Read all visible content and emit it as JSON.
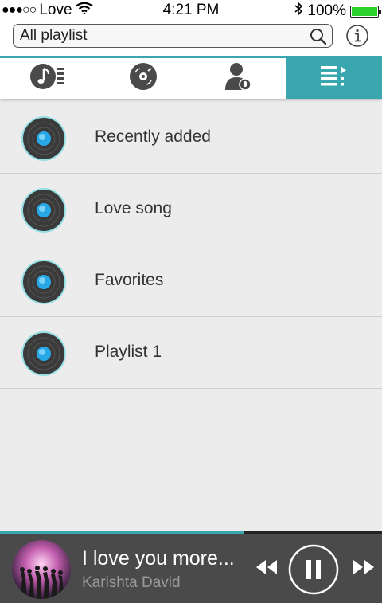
{
  "status_bar": {
    "signal": "●●●○○",
    "carrier": "Love",
    "time": "4:21 PM",
    "battery": "100%",
    "battery_level": 1.0
  },
  "search": {
    "value": "All playlist"
  },
  "tabs": [
    {
      "icon": "songs-icon",
      "active": false
    },
    {
      "icon": "albums-icon",
      "active": false
    },
    {
      "icon": "artists-icon",
      "active": false
    },
    {
      "icon": "playlists-icon",
      "active": true
    }
  ],
  "playlists": [
    {
      "label": "Recently added"
    },
    {
      "label": "Love song"
    },
    {
      "label": "Favorites"
    },
    {
      "label": "Playlist 1"
    }
  ],
  "player": {
    "title": "I love you more...",
    "artist": "Karishta David",
    "progress": 0.64
  },
  "colors": {
    "accent": "#3aa6ad",
    "player_bg": "#4a4a4a",
    "list_bg": "#ececec",
    "battery": "#2bd22b"
  }
}
